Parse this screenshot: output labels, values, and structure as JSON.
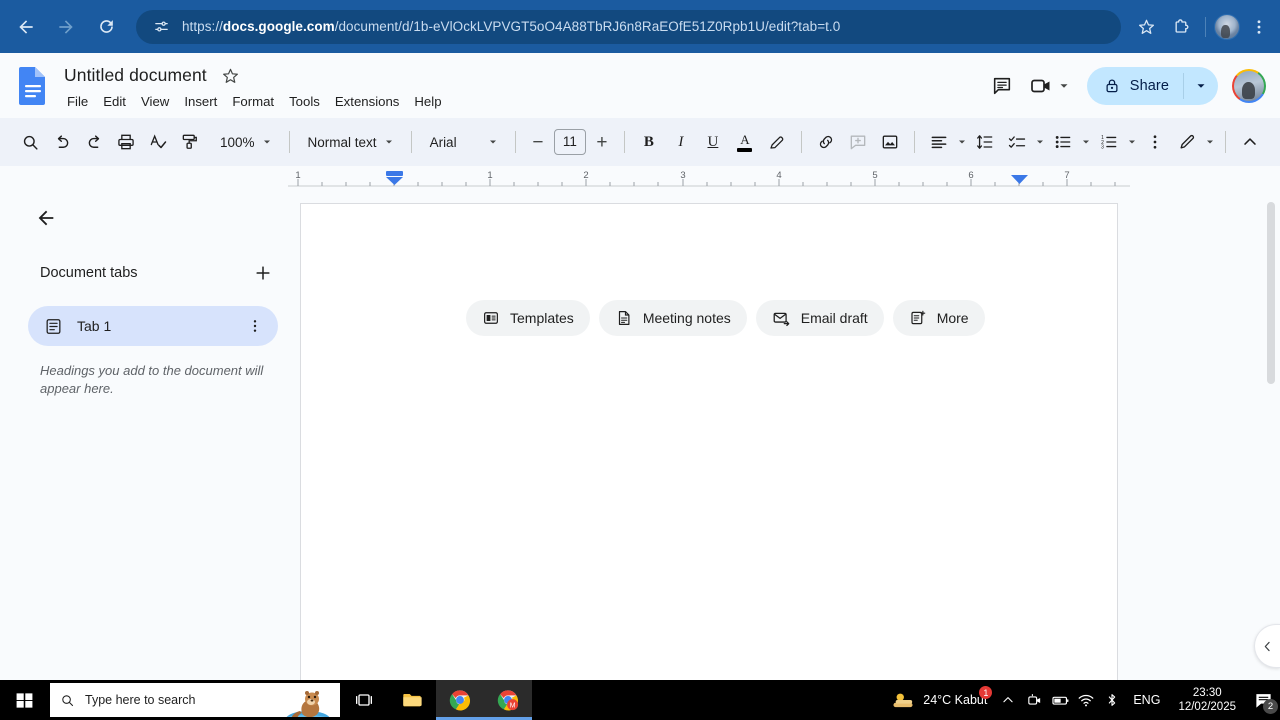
{
  "browser": {
    "url_prefix": "https://",
    "url_domain": "docs.google.com",
    "url_path": "/document/d/1b-eVlOckLVPVGT5oO4A88TbRJ6n8RaEOfE51Z0Rpb1U/edit?tab=t.0",
    "back_icon": "back-arrow-icon",
    "forward_icon": "forward-arrow-icon",
    "reload_icon": "reload-icon",
    "site_info_icon": "site-settings-icon",
    "bookmark_icon": "star-icon",
    "extensions_icon": "puzzle-icon",
    "menu_icon": "three-dot-menu-icon",
    "profile_icon": "profile-avatar",
    "bar_color": "#1b5ba0"
  },
  "docs": {
    "logo_icon": "google-docs-icon",
    "title": "Untitled document",
    "star_icon": "star-outline-icon",
    "menus": [
      "File",
      "Edit",
      "View",
      "Insert",
      "Format",
      "Tools",
      "Extensions",
      "Help"
    ],
    "header_right": {
      "comment_icon": "comment-history-icon",
      "meet_icon": "meet-camera-icon",
      "meet_caret_icon": "chevron-down-icon",
      "share_lock_icon": "lock-icon",
      "share_label": "Share",
      "share_caret_icon": "chevron-down-icon",
      "share_color": "#c2e7ff",
      "avatar": "account-avatar"
    }
  },
  "toolbar": {
    "search_icon": "search-icon",
    "undo_icon": "undo-icon",
    "redo_icon": "redo-icon",
    "print_icon": "print-icon",
    "spellcheck_icon": "spellcheck-icon",
    "paint_format_icon": "paint-format-icon",
    "zoom_value": "100%",
    "zoom_caret_icon": "chevron-down-icon",
    "style_value": "Normal text",
    "style_caret_icon": "chevron-down-icon",
    "font_value": "Arial",
    "font_caret_icon": "chevron-down-icon",
    "font_size_decrease": "−",
    "font_size_value": "11",
    "font_size_increase": "+",
    "bold_label": "B",
    "italic_label": "I",
    "underline_label": "U",
    "text_color_label": "A",
    "text_color_swatch": "#000000",
    "highlight_icon": "highlight-pen-icon",
    "link_icon": "insert-link-icon",
    "comment_icon": "add-comment-icon",
    "image_icon": "insert-image-icon",
    "align_icon": "align-left-icon",
    "align_caret_icon": "chevron-down-icon",
    "line_spacing_icon": "line-spacing-icon",
    "checklist_icon": "checklist-icon",
    "checklist_caret_icon": "chevron-down-icon",
    "bullet_list_icon": "bulleted-list-icon",
    "bullet_caret_icon": "chevron-down-icon",
    "numbered_list_icon": "numbered-list-icon",
    "numbered_caret_icon": "chevron-down-icon",
    "more_icon": "more-options-icon",
    "edit_mode_icon": "pencil-edit-icon",
    "edit_mode_caret_icon": "chevron-down-icon",
    "collapse_icon": "chevron-up-icon"
  },
  "ruler": {
    "numbers": [
      "1",
      "1",
      "2",
      "3",
      "4",
      "5",
      "6",
      "7"
    ],
    "left_indent_marker": "indent-marker",
    "right_indent_marker": "right-indent-marker"
  },
  "sidebar": {
    "back_icon": "back-arrow-icon",
    "title": "Document tabs",
    "add_icon": "add-tab-icon",
    "tabs": [
      {
        "icon": "document-tab-icon",
        "label": "Tab 1",
        "more_icon": "tab-options-icon"
      }
    ],
    "hint": "Headings you add to the document will appear here.",
    "selected_color": "#d7e3fc"
  },
  "document": {
    "chips": [
      {
        "icon": "templates-icon",
        "label": "Templates"
      },
      {
        "icon": "meeting-notes-icon",
        "label": "Meeting notes"
      },
      {
        "icon": "email-draft-icon",
        "label": "Email draft"
      },
      {
        "icon": "more-chip-icon",
        "label": "More"
      }
    ],
    "scrollbar": "vertical-scrollbar",
    "side_panel_toggle_icon": "chevron-left-icon"
  },
  "taskbar": {
    "start_icon": "windows-start-icon",
    "search_icon": "search-icon",
    "search_placeholder": "Type here to search",
    "search_image": "otter-illustration",
    "task_view_icon": "task-view-icon",
    "explorer_icon": "file-explorer-icon",
    "chrome_icon": "chrome-icon",
    "chrome_profile_icon": "chrome-profile-icon",
    "weather_icon": "weather-icon",
    "weather_badge": "1",
    "weather_text": "24°C  Kabut",
    "tray_expand_icon": "chevron-up-icon",
    "webcam_icon": "webcam-icon",
    "battery_icon": "battery-icon",
    "wifi_icon": "wifi-icon",
    "bluetooth_icon": "bluetooth-icon",
    "language": "ENG",
    "time": "23:30",
    "date": "12/02/2025",
    "notification_icon": "notification-icon",
    "notification_badge": "2"
  }
}
